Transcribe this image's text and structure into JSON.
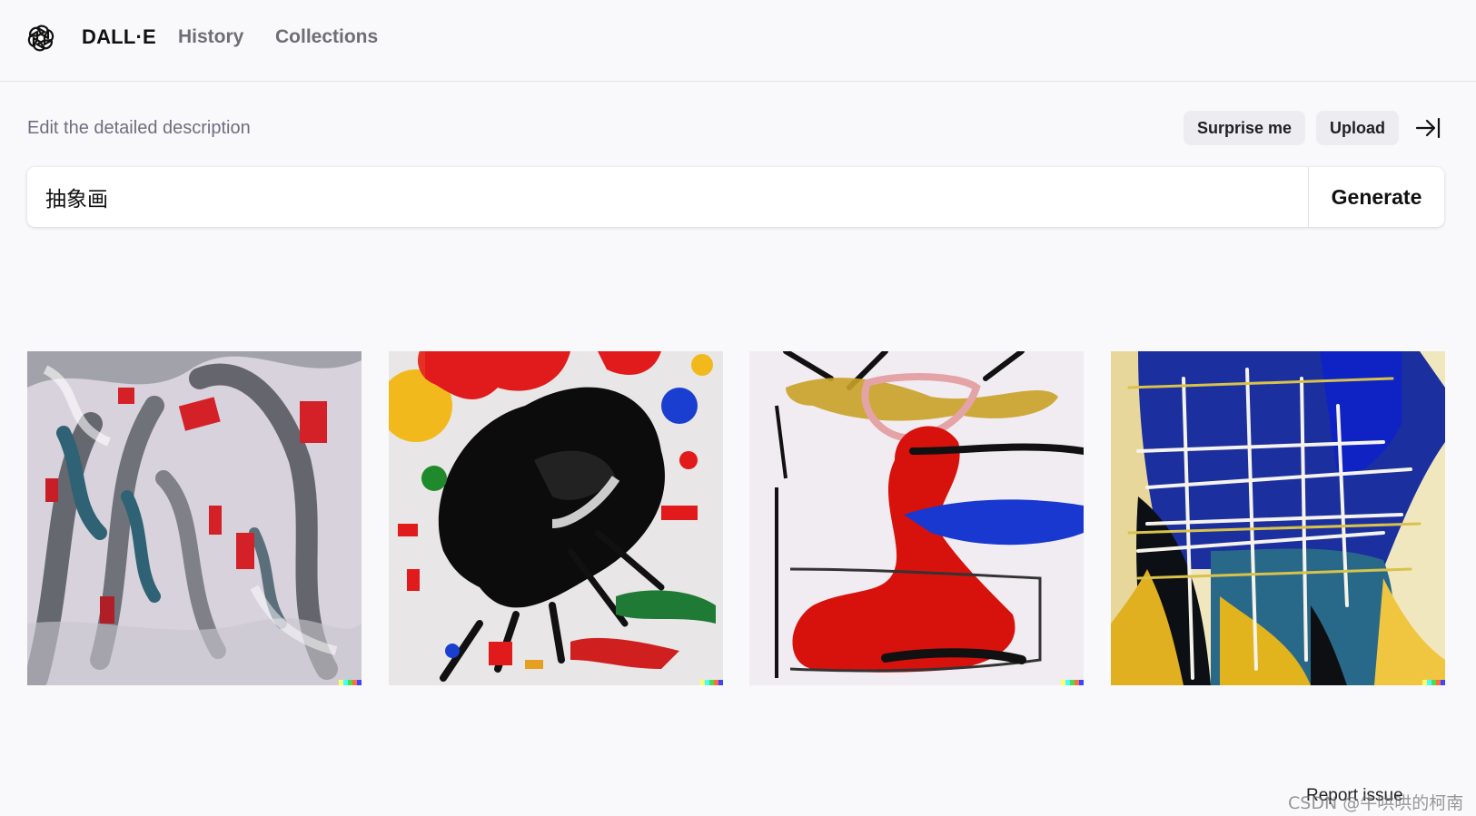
{
  "header": {
    "logo_icon": "openai-logo-icon",
    "brand": "DALL·E",
    "nav": {
      "history": "History",
      "collections": "Collections"
    }
  },
  "prompt": {
    "label": "Edit the detailed description",
    "surprise_label": "Surprise me",
    "upload_label": "Upload",
    "collapse_icon": "arrow-right-to-bar-icon",
    "value": "抽象画",
    "generate_label": "Generate"
  },
  "results": {
    "signature_colors": [
      "#ffff66",
      "#42ffff",
      "#51da4c",
      "#ff6e3c",
      "#3c46ff"
    ]
  },
  "footer": {
    "report_label": "Report issue",
    "report_icon": "flag-icon",
    "watermark": "CSDN @牛哄哄的柯南"
  }
}
